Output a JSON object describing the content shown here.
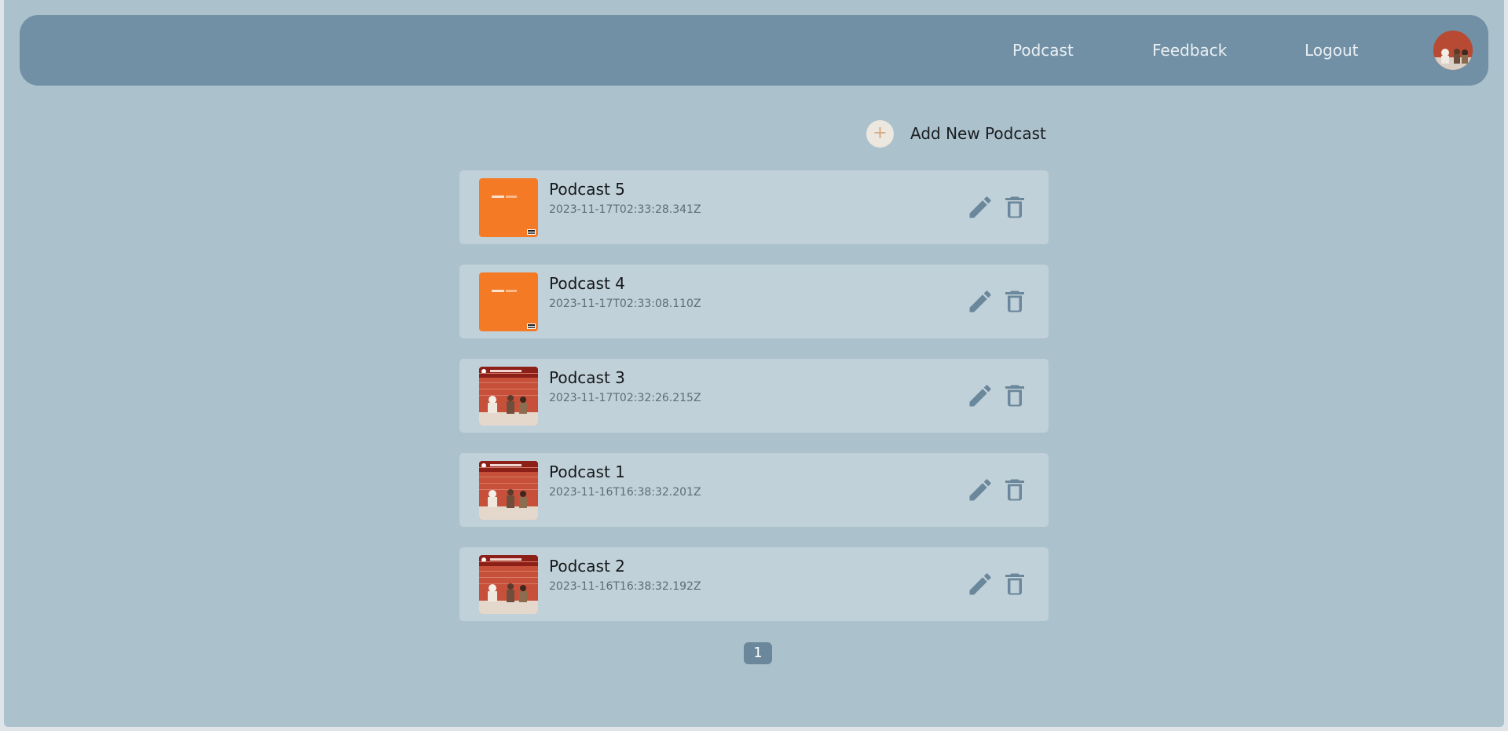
{
  "nav": {
    "podcast": "Podcast",
    "feedback": "Feedback",
    "logout": "Logout"
  },
  "add": {
    "label": "Add New Podcast"
  },
  "podcasts": [
    {
      "title": "Podcast 5",
      "date": "2023-11-17T02:33:28.341Z",
      "cover": "orange"
    },
    {
      "title": "Podcast 4",
      "date": "2023-11-17T02:33:08.110Z",
      "cover": "orange"
    },
    {
      "title": "Podcast 3",
      "date": "2023-11-17T02:32:26.215Z",
      "cover": "red"
    },
    {
      "title": "Podcast 1",
      "date": "2023-11-16T16:38:32.201Z",
      "cover": "red"
    },
    {
      "title": "Podcast 2",
      "date": "2023-11-16T16:38:32.192Z",
      "cover": "red"
    }
  ],
  "pagination": {
    "current": "1"
  },
  "icons": {
    "edit": "pencil-icon",
    "delete": "trash-icon",
    "add": "plus-icon"
  },
  "colors": {
    "accent": "#7190a5",
    "icon": "#6a879b"
  }
}
